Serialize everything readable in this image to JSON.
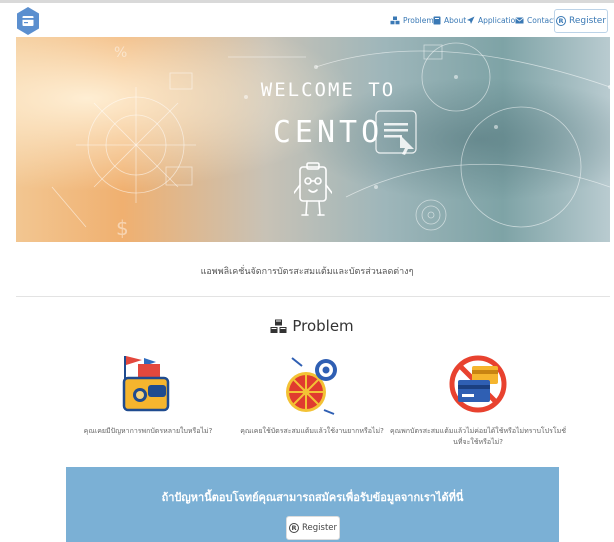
{
  "nav": {
    "items": [
      {
        "label": "Problem",
        "icon": "cubes-icon"
      },
      {
        "label": "About",
        "icon": "book-icon"
      },
      {
        "label": "Application",
        "icon": "rocket-icon"
      },
      {
        "label": "Contact",
        "icon": "envelope-icon"
      }
    ],
    "register_label": "Register"
  },
  "hero": {
    "title": "WELCOME TO",
    "brand": "CENTO"
  },
  "tagline": "แอพพลิเคชั่นจัดการบัตรสะสมแต้มและบัตรส่วนลดต่างๆ",
  "problem": {
    "title": "Problem",
    "items": [
      {
        "caption": "คุณเคยมีปัญหาการพกบัตรหลายใบหรือไม่?",
        "icon": "wallet-flag-icon"
      },
      {
        "caption": "คุณเคยใช้บัตรสะสมแต้มแล้วใช้งานยากหรือไม่?",
        "icon": "wheel-target-icon"
      },
      {
        "caption": "คุณพกบัตรสะสมแต้มแล้วไม่ค่อยได้ใช้หรือไม่ทราบโปรโมชั่นที่จะใช้หรือไม่?",
        "icon": "no-cards-icon"
      }
    ]
  },
  "cta": {
    "text": "ถ้าปัญหานี้ตอบโจทย์คุณสามารถสมัครเพื่อรับข้อมูลจากเราได้ที่นี่",
    "button_label": "Register"
  },
  "colors": {
    "accent": "#3a79b5",
    "cta_background": "#7bb0d5",
    "logo": "#5b8fcf"
  }
}
